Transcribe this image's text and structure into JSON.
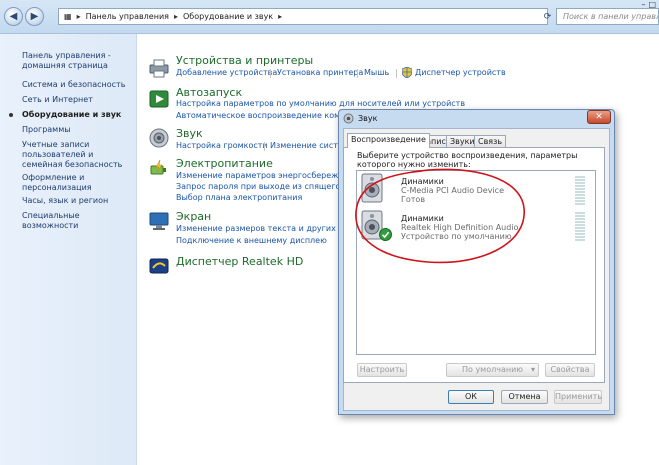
{
  "addressbar": {
    "crumbs": [
      "Панель управления",
      "Оборудование и звук"
    ],
    "search_placeholder": "Поиск в панели управления"
  },
  "sidebar": {
    "items": [
      {
        "label": "Панель управления - домашняя страница"
      },
      {
        "label": "Система и безопасность"
      },
      {
        "label": "Сеть и Интернет"
      },
      {
        "label": "Оборудование и звук",
        "current": true
      },
      {
        "label": "Программы"
      },
      {
        "label": "Учетные записи пользователей и семейная безопасность"
      },
      {
        "label": "Оформление и персонализация"
      },
      {
        "label": "Часы, язык и регион"
      },
      {
        "label": "Специальные возможности"
      }
    ]
  },
  "categories": [
    {
      "title": "Устройства и принтеры",
      "icon": "printer-icon",
      "links": [
        "Добавление устройства",
        "Установка принтера",
        "Мышь",
        "Диспетчер устройств"
      ]
    },
    {
      "title": "Автозапуск",
      "icon": "autoplay-icon",
      "links": [
        "Настройка параметров по умолчанию для носителей или устройств",
        "Автоматическое воспроизведение компакт-"
      ]
    },
    {
      "title": "Звук",
      "icon": "speaker-icon",
      "links": [
        "Настройка громкости",
        "Изменение систем"
      ]
    },
    {
      "title": "Электропитание",
      "icon": "power-icon",
      "links": [
        "Изменение параметров энергосбережения",
        "Запрос пароля при выходе из спящего ре",
        "Выбор плана электропитания"
      ]
    },
    {
      "title": "Экран",
      "icon": "display-icon",
      "links": [
        "Изменение размеров текста и других элемен",
        "Подключение к внешнему дисплею"
      ]
    },
    {
      "title": "Диспетчер Realtek HD",
      "icon": "realtek-icon",
      "links": []
    }
  ],
  "dialog": {
    "title": "Звук",
    "tabs": [
      "Воспроизведение",
      "Запись",
      "Звуки",
      "Связь"
    ],
    "instructions": "Выберите устройство воспроизведения, параметры которого нужно изменить:",
    "devices": [
      {
        "name": "Динамики",
        "driver": "C-Media PCI Audio Device",
        "status": "Готов",
        "default": false
      },
      {
        "name": "Динамики",
        "driver": "Realtek High Definition Audio",
        "status": "Устройство по умолчанию",
        "default": true
      }
    ],
    "buttons": {
      "configure": "Настроить",
      "set_default": "По умолчанию",
      "properties": "Свойства",
      "ok": "ОК",
      "cancel": "Отмена",
      "apply": "Применить"
    },
    "annotation_color": "#d0141c"
  },
  "colors": {
    "link": "#1a56a8",
    "category_title": "#1e6a2a",
    "sidebar_bg": "#e4eef9"
  }
}
